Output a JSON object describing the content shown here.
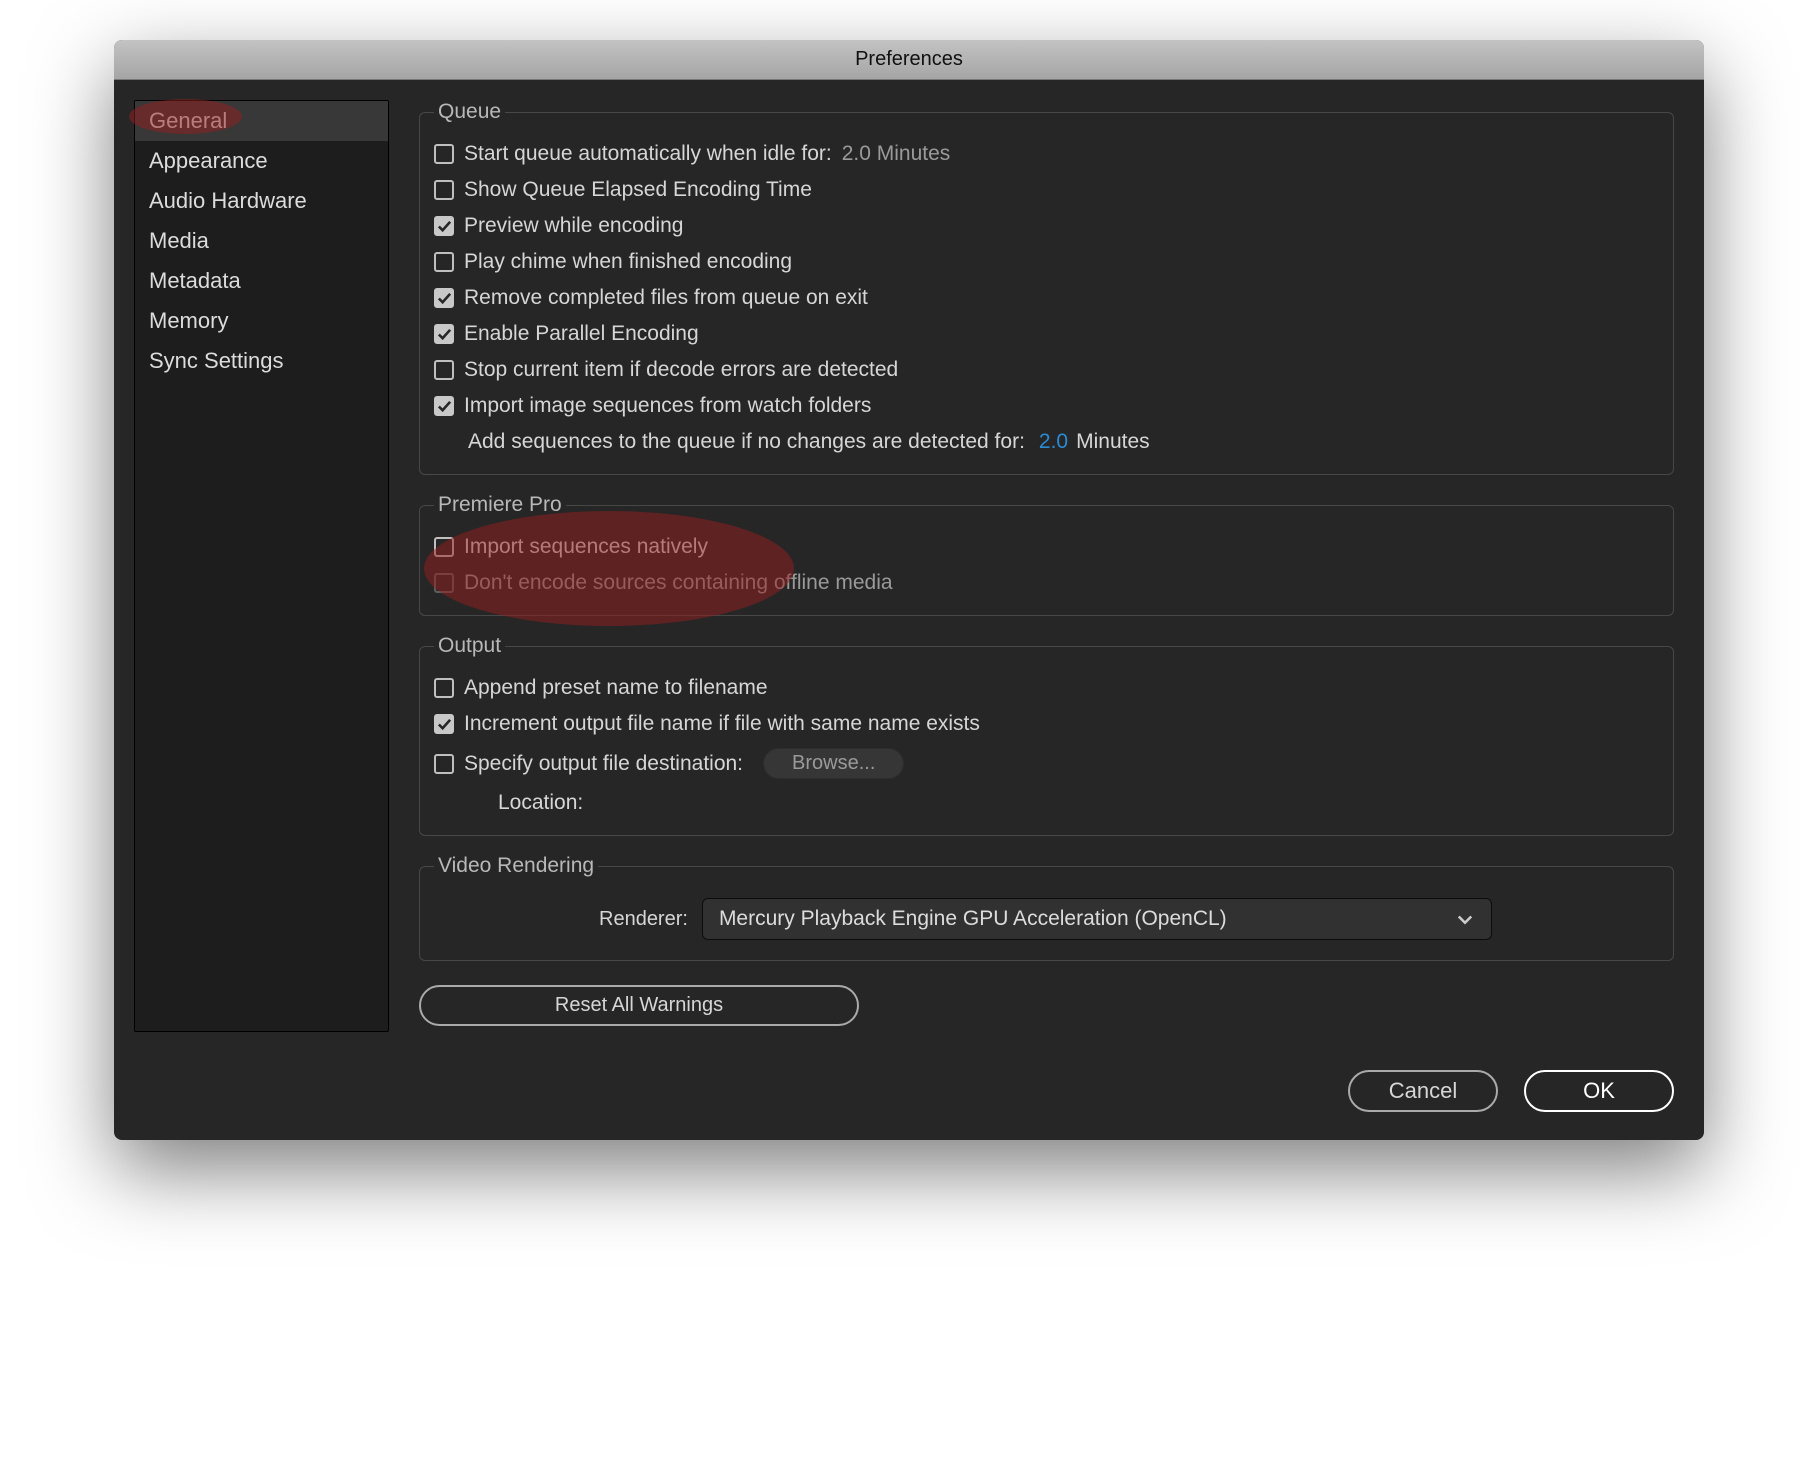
{
  "window": {
    "title": "Preferences"
  },
  "sidebar": {
    "items": [
      {
        "label": "General",
        "selected": true
      },
      {
        "label": "Appearance"
      },
      {
        "label": "Audio Hardware"
      },
      {
        "label": "Media"
      },
      {
        "label": "Metadata"
      },
      {
        "label": "Memory"
      },
      {
        "label": "Sync Settings"
      }
    ]
  },
  "groups": {
    "queue": {
      "legend": "Queue",
      "start_idle_label": "Start queue automatically when idle for:",
      "start_idle_value": "2.0 Minutes",
      "show_elapsed_label": "Show Queue Elapsed Encoding Time",
      "preview_label": "Preview while encoding",
      "chime_label": "Play chime when finished encoding",
      "remove_completed_label": "Remove completed files from queue on exit",
      "parallel_label": "Enable Parallel Encoding",
      "stop_decode_label": "Stop current item if decode errors are detected",
      "import_watch_label": "Import image sequences from watch folders",
      "add_sequences_label": "Add sequences to the queue if no changes are detected for:",
      "add_sequences_value": "2.0",
      "add_sequences_unit": "Minutes"
    },
    "premiere": {
      "legend": "Premiere Pro",
      "import_native_label": "Import sequences natively",
      "dont_encode_offline_label": "Don't encode sources containing offline media"
    },
    "output": {
      "legend": "Output",
      "append_preset_label": "Append preset name to filename",
      "increment_label": "Increment output file name if file with same name exists",
      "specify_dest_label": "Specify output file destination:",
      "browse_label": "Browse...",
      "location_label": "Location:"
    },
    "video": {
      "legend": "Video Rendering",
      "renderer_label": "Renderer:",
      "renderer_value": "Mercury Playback Engine GPU Acceleration (OpenCL)"
    }
  },
  "buttons": {
    "reset_warnings": "Reset All Warnings",
    "cancel": "Cancel",
    "ok": "OK"
  }
}
